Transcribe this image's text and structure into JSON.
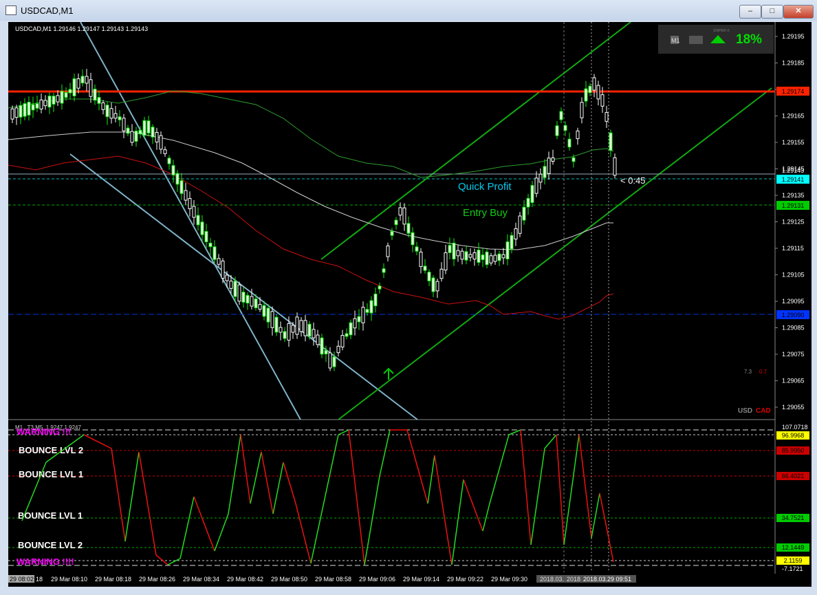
{
  "window": {
    "title": "USDCAD,M1",
    "min": "–",
    "max": "□",
    "close": "✕"
  },
  "main_chart": {
    "symbol_info": "USDCAD,M1  1.29146 1.29147 1.29143 1.29143",
    "price_ticks": [
      "1.29195",
      "1.29185",
      "1.29175",
      "1.29165",
      "1.29155",
      "1.29145",
      "1.29135",
      "1.29125",
      "1.29115",
      "1.29105",
      "1.29095",
      "1.29085",
      "1.29075",
      "1.29065",
      "1.29055"
    ],
    "badges": {
      "red": "1.29174",
      "bid_top": "1.29143",
      "cyan": "1.29141",
      "green": "1.29131",
      "blue": "1.29090"
    },
    "labels": {
      "quick_profit": "Quick Profit",
      "entry_buy": "Entry Buy",
      "countdown": "< 0:45"
    },
    "strength": {
      "value": "18%",
      "brand": "SNIPER-X"
    },
    "mini_values": {
      "a": "7.3",
      "b": "0.7"
    },
    "currency": {
      "base": "USD",
      "quote": "CAD"
    }
  },
  "indicator": {
    "info": "M1 . T3 M5 .1.9247 1.9247",
    "warning_top": "WARNING !!!",
    "bounce2_top": "BOUNCE LVL 2",
    "bounce1_top": "BOUNCE LVL 1",
    "bounce1_bottom": "BOUNCE LVL 1",
    "bounce2_bottom": "BOUNCE LVL 2",
    "warning_bottom": "WARNING !!!!",
    "scale": {
      "top": "107.0718",
      "bottom": "-7.1721"
    },
    "levels": [
      "96.9968",
      "85.9950",
      "66.4021",
      "34.7521",
      "12.1449",
      "2.1159"
    ]
  },
  "time_axis": {
    "first": "29 08:02",
    "ticks": [
      "29 Mar 08:10",
      "29 Mar 08:18",
      "29 Mar 08:26",
      "29 Mar 08:34",
      "29 Mar 08:42",
      "29 Mar 08:50",
      "29 Mar 08:58",
      "29 Mar 09:06",
      "29 Mar 09:14",
      "29 Mar 09:22",
      "29 Mar 09:30"
    ],
    "ticks_partial": [
      "2018.03.",
      "2018",
      "2018.03.29 09:51"
    ],
    "partial_suffix": "18"
  },
  "colors": {
    "bg": "#000000",
    "bull": "#ffffff",
    "bear": "#00ff00",
    "red": "#ff2200",
    "cyan": "#00ffff",
    "green": "#00c800",
    "blue": "#0044ff"
  }
}
